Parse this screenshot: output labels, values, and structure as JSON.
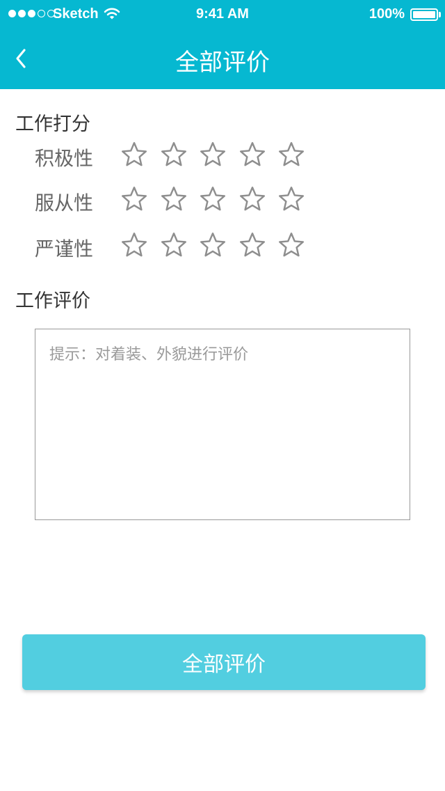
{
  "status_bar": {
    "carrier": "Sketch",
    "time": "9:41 AM",
    "battery": "100%"
  },
  "nav": {
    "back_icon": "chevron-left-icon",
    "title": "全部评价"
  },
  "score_section": {
    "title": "工作打分",
    "max_stars": 5,
    "rows": [
      {
        "label": "积极性",
        "rating": 0
      },
      {
        "label": "服从性",
        "rating": 0
      },
      {
        "label": "严谨性",
        "rating": 0
      }
    ]
  },
  "review_section": {
    "title": "工作评价",
    "placeholder": "提示：对着装、外貌进行评价",
    "value": ""
  },
  "submit": {
    "label": "全部评价"
  },
  "colors": {
    "header": "#06B8D1",
    "button": "#52CEE0",
    "star_outline": "#8E8E8E"
  }
}
